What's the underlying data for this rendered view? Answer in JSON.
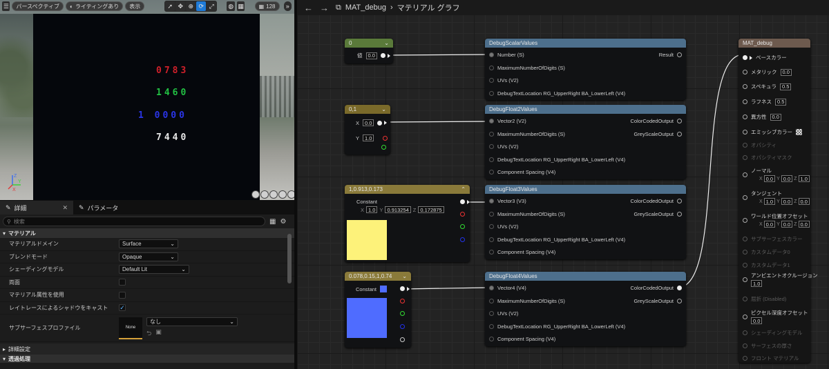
{
  "viewport": {
    "toolbar": {
      "perspective": "パースペクティブ",
      "lighting": "ライティングあり",
      "show": "表示",
      "grid_value": "128"
    },
    "digits": [
      {
        "text": "0783",
        "color": "#d0202a"
      },
      {
        "text": "1460",
        "color": "#22c043"
      },
      {
        "text": "1 0000",
        "color": "#2a35e8"
      },
      {
        "text": "7440",
        "color": "#e8e8e8"
      }
    ]
  },
  "details": {
    "tab_details": "詳細",
    "tab_params": "パラメータ",
    "search_placeholder": "検索",
    "category_material": "マテリアル",
    "rows": [
      {
        "label": "マテリアルドメイン",
        "value": "Surface"
      },
      {
        "label": "ブレンドモード",
        "value": "Opaque"
      },
      {
        "label": "シェーディングモデル",
        "value": "Default Lit"
      },
      {
        "label": "両面",
        "value": ""
      },
      {
        "label": "マテリアル属性を使用",
        "value": ""
      },
      {
        "label": "レイトレースによるシャドウをキャスト",
        "value": "✓"
      },
      {
        "label": "サブサーフェスプロファイル",
        "value": "なし"
      }
    ],
    "profile_thumb": "None",
    "category_advanced": "詳細設定",
    "category_translucency": "透過処理"
  },
  "graph": {
    "title": "MAT_debug",
    "subtitle": "マテリアル グラフ",
    "nodes": {
      "scalar": {
        "title": "0",
        "label": "値",
        "value": "0.0"
      },
      "vec2": {
        "title": "0,1",
        "x": "0.0",
        "y": "1.0"
      },
      "vec3": {
        "title": "1,0.913,0.173",
        "label": "Constant",
        "x": "1.0",
        "y": "0.913254",
        "z": "0.172875",
        "color": "#fdf27a"
      },
      "vec4": {
        "title": "0.078,0.15,1,0.74",
        "label": "Constant",
        "color": "#4f6cff"
      },
      "debug_scalar": {
        "title": "DebugScalarValues",
        "pins": [
          "Number (S)",
          "MaximumNumberOfDigits (S)",
          "UVs (V2)",
          "DebugTextLocation RG_UpperRight BA_LowerLeft (V4)"
        ],
        "out": "Result"
      },
      "debug_f2": {
        "title": "DebugFloat2Values",
        "pins": [
          "Vector2 (V2)",
          "MaximumNumberOfDigits (S)",
          "UVs (V2)",
          "DebugTextLocation RG_UpperRight BA_LowerLeft (V4)",
          "Component Spacing (V4)"
        ],
        "out1": "ColorCodedOutput",
        "out2": "GreyScaleOutput"
      },
      "debug_f3": {
        "title": "DebugFloat3Values",
        "pins": [
          "Vector3 (V3)",
          "MaximumNumberOfDigits (S)",
          "UVs (V2)",
          "DebugTextLocation RG_UpperRight BA_LowerLeft (V4)",
          "Component Spacing (V4)"
        ],
        "out1": "ColorCodedOutput",
        "out2": "GreyScaleOutput"
      },
      "debug_f4": {
        "title": "DebugFloat4Values",
        "pins": [
          "Vector4 (V4)",
          "MaximumNumberOfDigits (S)",
          "UVs (V2)",
          "DebugTextLocation RG_UpperRight BA_LowerLeft (V4)",
          "Component Spacing (V4)"
        ],
        "out1": "ColorCodedOutput",
        "out2": "GreyScaleOutput"
      }
    },
    "material_node": {
      "title": "MAT_debug",
      "inputs": [
        {
          "label": "ベースカラー",
          "value": "",
          "enabled": true
        },
        {
          "label": "メタリック",
          "value": "0.0",
          "enabled": true
        },
        {
          "label": "スペキュラ",
          "value": "0.5",
          "enabled": true
        },
        {
          "label": "ラフネス",
          "value": "0.5",
          "enabled": true
        },
        {
          "label": "異方性",
          "value": "0.0",
          "enabled": true
        },
        {
          "label": "エミッシブカラー",
          "value": "",
          "enabled": true
        },
        {
          "label": "オパシティ",
          "value": "",
          "enabled": false
        },
        {
          "label": "オパシティマスク",
          "value": "",
          "enabled": false
        },
        {
          "label": "ノーマル",
          "value": "",
          "enabled": true
        },
        {
          "label": "タンジェント",
          "value": "",
          "enabled": true
        },
        {
          "label": "ワールド位置オフセット",
          "value": "",
          "enabled": true
        },
        {
          "label": "サブサーフェスカラー",
          "value": "",
          "enabled": false
        },
        {
          "label": "カスタムデータ0",
          "value": "",
          "enabled": false
        },
        {
          "label": "カスタムデータ1",
          "value": "",
          "enabled": false
        },
        {
          "label": "アンビエントオクルージョン",
          "value": "1.0",
          "enabled": true
        },
        {
          "label": "屈折 (Disabled)",
          "value": "",
          "enabled": false
        },
        {
          "label": "ピクセル深度オフセット",
          "value": "0.0",
          "enabled": true
        },
        {
          "label": "シェーディングモデル",
          "value": "",
          "enabled": false
        },
        {
          "label": "サーフェスの厚さ",
          "value": "",
          "enabled": false
        },
        {
          "label": "フロント マテリアル",
          "value": "",
          "enabled": false
        }
      ],
      "normal": {
        "x": "0.0",
        "y": "0.0",
        "z": "1.0"
      },
      "tangent": {
        "x": "1.0",
        "y": "0.0",
        "z": "0.0"
      },
      "wpo": {
        "x": "0.0",
        "y": "0.0",
        "z": "0.0"
      }
    }
  }
}
